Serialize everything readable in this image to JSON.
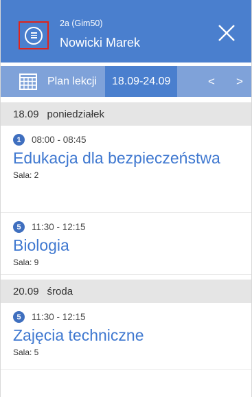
{
  "header": {
    "class_label": "2a (Gim50)",
    "student_name": "Nowicki Marek"
  },
  "toolbar": {
    "plan_label": "Plan lekcji",
    "date_range": "18.09-24.09",
    "prev_label": "<",
    "next_label": ">"
  },
  "days": [
    {
      "date": "18.09",
      "day_name": "poniedziałek",
      "lessons": [
        {
          "number": "1",
          "time": "08:00 - 08:45",
          "subject": "Edukacja dla bezpieczeństwa",
          "room": "Sala: 2"
        },
        {
          "number": "5",
          "time": "11:30 - 12:15",
          "subject": "Biologia",
          "room": "Sala: 9"
        }
      ]
    },
    {
      "date": "20.09",
      "day_name": "środa",
      "lessons": [
        {
          "number": "5",
          "time": "11:30 - 12:15",
          "subject": "Zajęcia techniczne",
          "room": "Sala: 5"
        }
      ]
    }
  ],
  "colors": {
    "header_bg": "#4a7fce",
    "toolbar_bg": "#7fa2d9",
    "subject_text": "#3f78d0",
    "day_header_bg": "#e5e5e5",
    "highlight_border": "#e0241b"
  }
}
